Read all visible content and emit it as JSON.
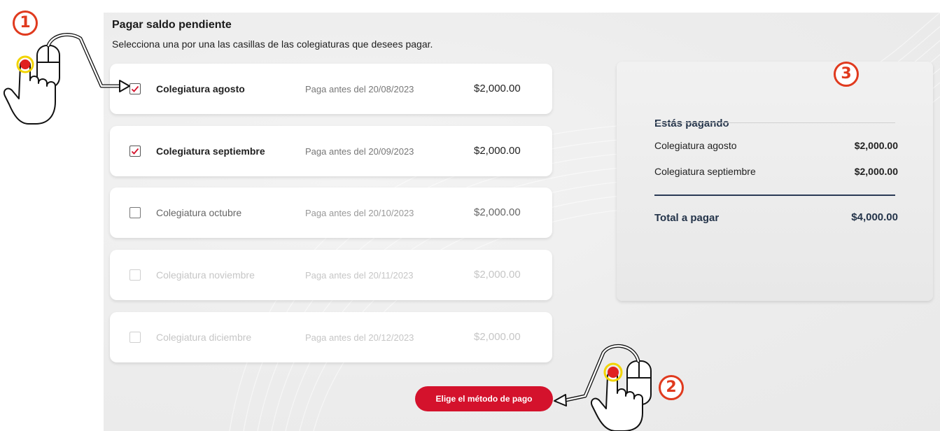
{
  "page": {
    "title": "Pagar saldo pendiente",
    "subtitle": "Selecciona una por una las casillas de las colegiaturas que desees pagar."
  },
  "items": [
    {
      "name": "Colegiatura agosto",
      "due": "Paga antes del 20/08/2023",
      "amount": "$2,000.00",
      "checked": true
    },
    {
      "name": "Colegiatura septiembre",
      "due": "Paga antes del 20/09/2023",
      "amount": "$2,000.00",
      "checked": true
    },
    {
      "name": "Colegiatura octubre",
      "due": "Paga antes del 20/10/2023",
      "amount": "$2,000.00",
      "checked": false
    },
    {
      "name": "Colegiatura noviembre",
      "due": "Paga antes del 20/11/2023",
      "amount": "$2,000.00",
      "checked": false
    },
    {
      "name": "Colegiatura diciembre",
      "due": "Paga antes del 20/12/2023",
      "amount": "$2,000.00",
      "checked": false
    }
  ],
  "summary": {
    "title": "Estás pagando",
    "rows": [
      {
        "label": "Colegiatura agosto",
        "amount": "$2,000.00"
      },
      {
        "label": "Colegiatura septiembre",
        "amount": "$2,000.00"
      }
    ],
    "total_label": "Total a pagar",
    "total_amount": "$4,000.00"
  },
  "actions": {
    "pay_button": "Elige el método de pago"
  },
  "steps": [
    "1",
    "2",
    "3"
  ],
  "colors": {
    "accent_red": "#d4122c",
    "step_orange": "#e03a1e",
    "navy": "#24344a"
  },
  "icons": [
    "checkmark-icon",
    "pointing-hand-icon",
    "arrow-icon"
  ]
}
